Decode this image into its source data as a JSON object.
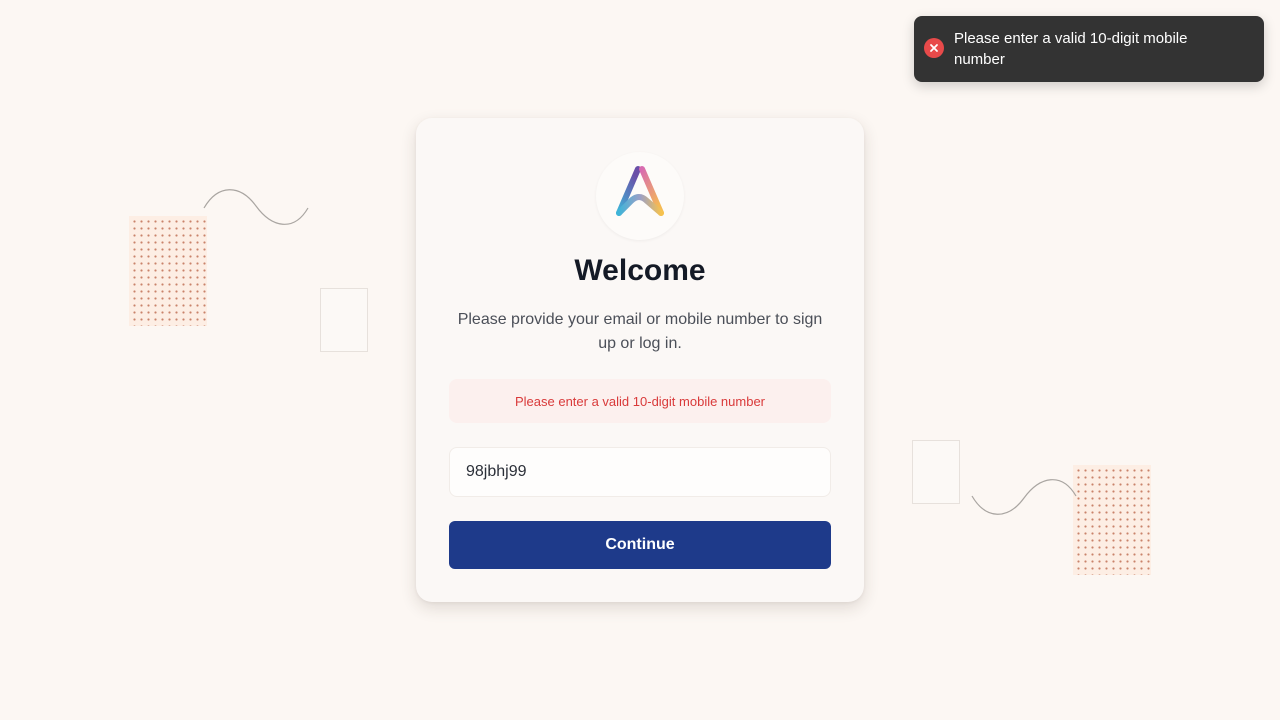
{
  "toast": {
    "message": "Please enter a valid 10-digit mobile number",
    "icon": "error-icon",
    "background": "#333333",
    "icon_color": "#e84a4a"
  },
  "login": {
    "title": "Welcome",
    "subtitle": "Please provide your email or mobile number to sign up or log in.",
    "error_message": "Please enter a valid 10-digit mobile number",
    "input_value": "98jbhj99",
    "continue_label": "Continue",
    "logo_icon": "app-logo-icon"
  },
  "colors": {
    "background": "#fcf7f3",
    "primary_button": "#1e3a8a",
    "error_text": "#d93a3a",
    "error_background": "#fcf0ee"
  }
}
